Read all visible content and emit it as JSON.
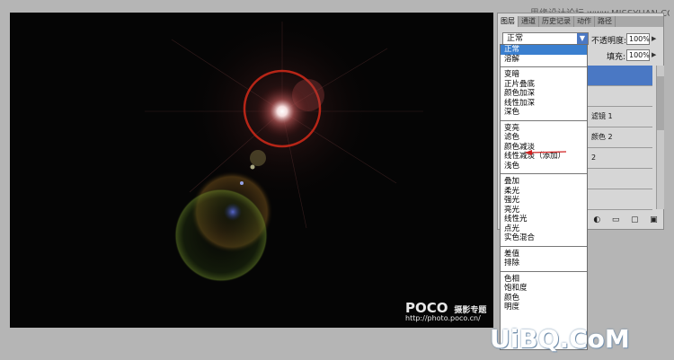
{
  "canvas": {
    "watermark_brand": "POCO",
    "watermark_sub": "摄影专题",
    "watermark_url": "http://photo.poco.cn/"
  },
  "panel": {
    "site_watermark": "思缘设计论坛 www.MISSYUAN.COM",
    "tabs": [
      "图层",
      "通道",
      "历史记录",
      "动作",
      "路径"
    ],
    "blend_mode": "正常",
    "opacity_label": "不透明度:",
    "opacity_value": "100%",
    "fill_label": "填充:",
    "fill_value": "100%",
    "layers": [
      "",
      "",
      "滤镜 1",
      "颜色 2",
      "2",
      "",
      ""
    ]
  },
  "blend_menu": {
    "groups": [
      [
        "正常",
        "溶解"
      ],
      [
        "变暗",
        "正片叠底",
        "颜色加深",
        "线性加深",
        "深色"
      ],
      [
        "变亮",
        "滤色",
        "颜色减淡",
        "线性减淡（添加）",
        "浅色"
      ],
      [
        "叠加",
        "柔光",
        "强光",
        "亮光",
        "线性光",
        "点光",
        "实色混合"
      ],
      [
        "差值",
        "排除"
      ],
      [
        "色相",
        "饱和度",
        "颜色",
        "明度"
      ]
    ],
    "selected": "正常",
    "highlighted": "滤色"
  },
  "footer_watermark": "UiBQ.CoM",
  "colors": {
    "selection": "#3a7fcf",
    "flare_core": "#ffffff",
    "flare_ring": "#d03020",
    "arrow": "#d02020"
  }
}
